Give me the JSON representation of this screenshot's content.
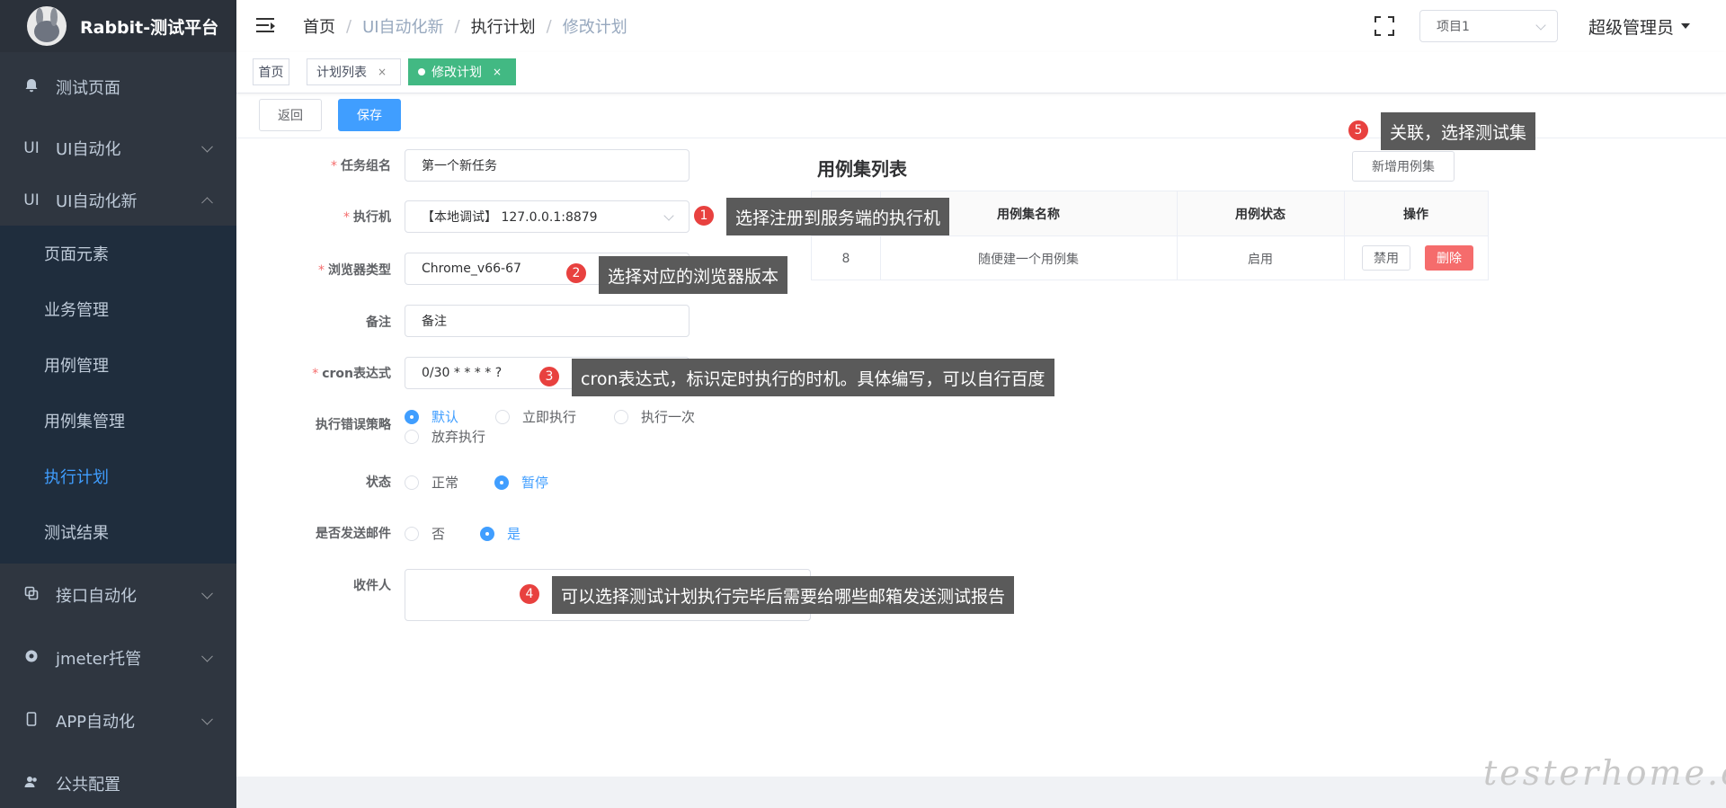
{
  "sidebar": {
    "logo_title": "Rabbit-测试平台",
    "items": [
      {
        "label": "测试页面",
        "icon": "bell-icon"
      },
      {
        "label": "UI自动化",
        "icon_text": "UI"
      },
      {
        "label": "UI自动化新",
        "icon_text": "UI"
      },
      {
        "label": "接口自动化",
        "icon": "copy-icon"
      },
      {
        "label": "jmeter托管",
        "icon": "settings-icon"
      },
      {
        "label": "APP自动化",
        "icon": "phone-icon"
      },
      {
        "label": "公共配置",
        "icon": "users-icon"
      }
    ],
    "sub_items": [
      {
        "label": "页面元素"
      },
      {
        "label": "业务管理"
      },
      {
        "label": "用例管理"
      },
      {
        "label": "用例集管理"
      },
      {
        "label": "执行计划",
        "active": true
      },
      {
        "label": "测试结果"
      }
    ]
  },
  "header": {
    "breadcrumb": [
      "首页",
      "UI自动化新",
      "执行计划",
      "修改计划"
    ],
    "separator": "/",
    "project_select": "项目1",
    "user": "超级管理员"
  },
  "tags": {
    "items": [
      "首页",
      "计划列表",
      "修改计划"
    ],
    "close": "×"
  },
  "actions": {
    "back": "返回",
    "save": "保存"
  },
  "form": {
    "required_mark": "*",
    "task_name": {
      "label": "任务组名",
      "value": "第一个新任务"
    },
    "executor": {
      "label": "执行机",
      "value": "【本地调试】 127.0.0.1:8879"
    },
    "browser": {
      "label": "浏览器类型",
      "value": "Chrome_v66-67"
    },
    "remark": {
      "label": "备注",
      "value": "备注"
    },
    "cron": {
      "label": "cron表达式",
      "value": "0/30 * * * * ?"
    },
    "error_strategy": {
      "label": "执行错误策略",
      "options": [
        "默认",
        "立即执行",
        "执行一次",
        "放弃执行"
      ],
      "selected": "默认"
    },
    "status": {
      "label": "状态",
      "options": [
        "正常",
        "暂停"
      ],
      "selected": "暂停"
    },
    "send_mail": {
      "label": "是否发送邮件",
      "options": [
        "否",
        "是"
      ],
      "selected": "是"
    },
    "recipients": {
      "label": "收件人",
      "value": ""
    }
  },
  "suite_panel": {
    "title": "用例集列表",
    "add_button": "新增用例集",
    "columns": [
      "",
      "用例集名称",
      "用例状态",
      "操作"
    ],
    "rows": [
      {
        "id": "8",
        "name": "随便建一个用例集",
        "status": "启用",
        "actions": [
          "禁用",
          "删除"
        ]
      }
    ]
  },
  "callouts": [
    {
      "number": "1",
      "text": "选择注册到服务端的执行机"
    },
    {
      "number": "2",
      "text": "选择对应的浏览器版本"
    },
    {
      "number": "3",
      "text": "cron表达式，标识定时执行的时机。具体编写，可以自行百度"
    },
    {
      "number": "4",
      "text": "可以选择测试计划执行完毕后需要给哪些邮箱发送测试报告"
    },
    {
      "number": "5",
      "text": "关联，选择测试集"
    }
  ],
  "watermark": "testerhome.com",
  "colors": {
    "sidebar_bg": "#2f3640",
    "primary": "#409eff",
    "tag_active": "#42b983",
    "danger": "#f56c6c",
    "callout_bg": "#5a5a5a",
    "badge": "#e8413f"
  }
}
